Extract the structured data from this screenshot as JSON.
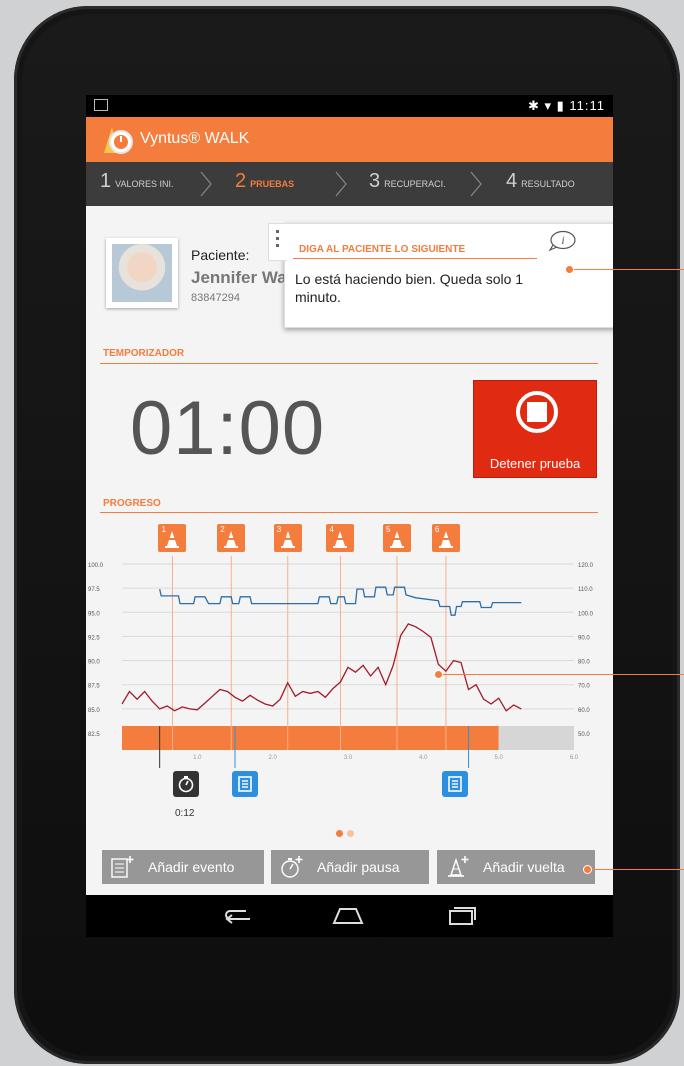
{
  "status": {
    "time": "11:11"
  },
  "app": {
    "title": "Vyntus® WALK"
  },
  "steps": [
    {
      "num": "1",
      "label": "VALORES INI.",
      "active": false
    },
    {
      "num": "2",
      "label": "PRUEBAS",
      "active": true
    },
    {
      "num": "3",
      "label": "RECUPERACI.",
      "active": false
    },
    {
      "num": "4",
      "label": "RESULTADO",
      "active": false
    }
  ],
  "patient": {
    "label": "Paciente:",
    "name": "Jennifer Wal",
    "id": "83847294"
  },
  "message": {
    "header": "DIGA AL PACIENTE LO SIGUIENTE",
    "text": "Lo está haciendo bien. Queda solo 1 minuto."
  },
  "timer": {
    "section": "TEMPORIZADOR",
    "value": "01:00"
  },
  "stop_button": {
    "label": "Detener prueba"
  },
  "progress": {
    "section": "PROGRESO",
    "cones": [
      "1",
      "2",
      "3",
      "4",
      "5",
      "6"
    ],
    "marker_label": "0:12"
  },
  "chart_data": {
    "type": "line",
    "y_left_ticks": [
      "100.0",
      "97.5",
      "95.0",
      "92.5",
      "90.0",
      "87.5",
      "85.0",
      "82.5"
    ],
    "y_right_ticks": [
      "120.0",
      "110.0",
      "100.0",
      "90.0",
      "80.0",
      "70.0",
      "60.0",
      "50.0"
    ],
    "x_ticks": [
      "1.0",
      "2.0",
      "3.0",
      "4.0",
      "5.0",
      "6.0"
    ],
    "ylim_left": [
      82.5,
      100
    ],
    "ylim_right": [
      50,
      120
    ],
    "xlim": [
      0,
      6
    ],
    "progress_end": 5,
    "lap_times": [
      0.67,
      1.45,
      2.2,
      2.9,
      3.65,
      4.3
    ],
    "series": [
      {
        "axis": "left",
        "color": "#2e6fa8",
        "x": [
          0.5,
          0.52,
          0.75,
          0.77,
          0.95,
          0.97,
          1.1,
          1.15,
          1.3,
          1.32,
          1.45,
          1.47,
          1.55,
          1.57,
          1.7,
          1.72,
          2.6,
          2.62,
          2.75,
          2.77,
          2.85,
          2.87,
          2.95,
          2.97,
          3.1,
          3.12,
          3.2,
          3.22,
          3.35,
          3.37,
          3.5,
          3.52,
          3.6,
          3.62,
          3.75,
          3.77,
          3.9,
          4.2,
          4.22,
          4.35,
          4.37,
          4.42,
          4.44,
          4.5,
          4.52,
          4.75,
          4.77,
          4.9,
          4.92,
          5.3
        ],
        "y": [
          97.4,
          96.7,
          96.7,
          95.9,
          95.9,
          96.6,
          96.6,
          95.9,
          95.9,
          96.6,
          96.6,
          95.9,
          95.9,
          96.6,
          96.6,
          95.9,
          95.9,
          96.6,
          96.6,
          95.9,
          95.9,
          96.6,
          96.6,
          95.9,
          95.9,
          97.4,
          97.4,
          96.6,
          96.6,
          97.6,
          97.6,
          96.8,
          96.8,
          97.6,
          97.6,
          96.8,
          96.5,
          96.2,
          95.6,
          95.6,
          94.7,
          94.7,
          95.6,
          95.6,
          96.1,
          96.1,
          95.5,
          95.5,
          96.0,
          96.0
        ]
      },
      {
        "axis": "left",
        "color": "#a01b2b",
        "x": [
          0.0,
          0.1,
          0.2,
          0.3,
          0.4,
          0.5,
          0.6,
          0.7,
          0.8,
          0.9,
          1.0,
          1.1,
          1.2,
          1.3,
          1.4,
          1.5,
          1.6,
          1.7,
          1.8,
          1.9,
          2.0,
          2.1,
          2.2,
          2.3,
          2.4,
          2.5,
          2.6,
          2.7,
          2.8,
          2.9,
          3.0,
          3.1,
          3.2,
          3.3,
          3.4,
          3.5,
          3.6,
          3.7,
          3.8,
          3.9,
          4.0,
          4.1,
          4.2,
          4.3,
          4.4,
          4.5,
          4.6,
          4.7,
          4.8,
          4.9,
          5.0,
          5.1,
          5.2,
          5.3
        ],
        "y": [
          85.5,
          86.8,
          86.0,
          86.8,
          85.8,
          85.0,
          85.3,
          84.8,
          85.2,
          85.0,
          84.9,
          85.6,
          86.3,
          87.0,
          86.8,
          86.2,
          85.8,
          86.4,
          85.9,
          85.5,
          85.3,
          86.0,
          87.7,
          86.3,
          86.8,
          86.6,
          86.8,
          86.2,
          87.1,
          87.8,
          89.3,
          88.8,
          89.5,
          88.4,
          89.3,
          87.5,
          89.5,
          92.6,
          93.8,
          93.5,
          93.0,
          92.4,
          89.6,
          88.9,
          90.0,
          89.8,
          87.0,
          87.5,
          86.0,
          85.5,
          86.1,
          84.8,
          85.4,
          85.0
        ]
      }
    ]
  },
  "buttons": [
    {
      "label": "Añadir evento",
      "icon": "add-event-icon"
    },
    {
      "label": "Añadir pausa",
      "icon": "add-pause-icon"
    },
    {
      "label": "Añadir vuelta",
      "icon": "add-lap-icon"
    }
  ],
  "colors": {
    "accent": "#f47c3c",
    "stop": "#e02a12",
    "header_dark": "#3c3c3c",
    "series_blue": "#2e6fa8",
    "series_red": "#a01b2b"
  }
}
